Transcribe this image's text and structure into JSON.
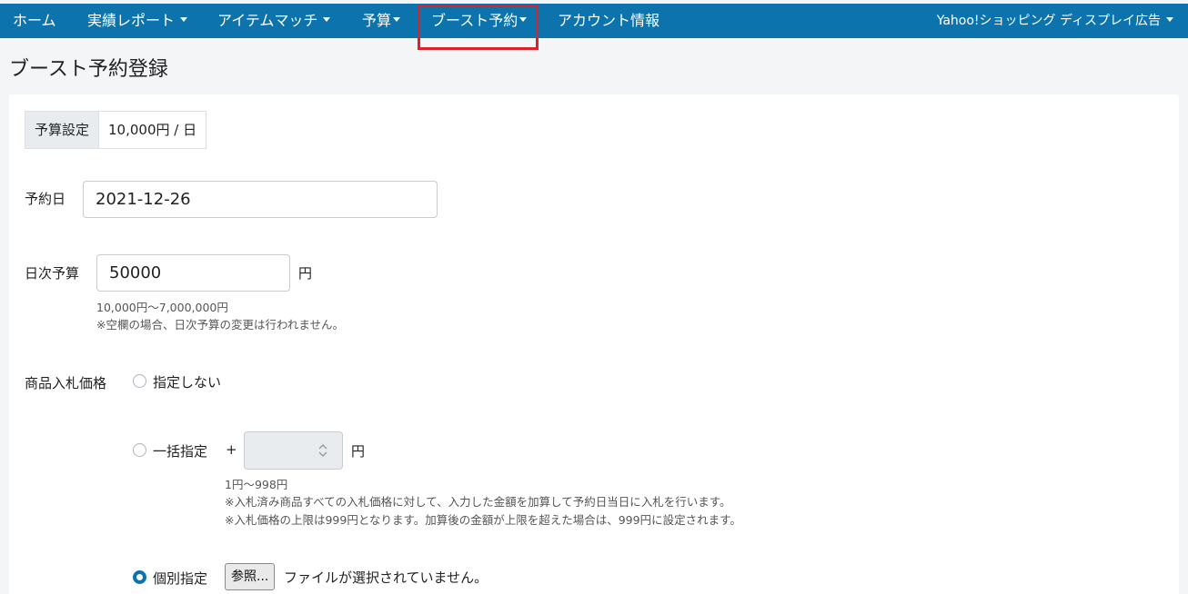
{
  "navbar": {
    "items": [
      {
        "label": "ホーム",
        "dropdown": false
      },
      {
        "label": "実績レポート",
        "dropdown": true
      },
      {
        "label": "アイテムマッチ",
        "dropdown": true
      },
      {
        "label": "予算",
        "dropdown": true
      },
      {
        "label": "ブースト予約",
        "dropdown": true,
        "active": true
      },
      {
        "label": "アカウント情報",
        "dropdown": false
      }
    ],
    "account": "Yahoo!ショッピング ディスプレイ広告",
    "bg_color": "#0c73ad",
    "highlight_color": "#d9222a"
  },
  "page": {
    "title": "ブースト予約登録"
  },
  "budget": {
    "label": "予算設定",
    "value": "10,000円 / 日"
  },
  "reservation_date": {
    "label": "予約日",
    "value": "2021-12-26"
  },
  "daily_budget": {
    "label": "日次予算",
    "value": "50000",
    "unit": "円",
    "range": "10,000円～7,000,000円",
    "note": "※空欄の場合、日次予算の変更は行われません。"
  },
  "bid_price": {
    "label": "商品入札価格",
    "options": {
      "none": "指定しない",
      "bulk": "一括指定",
      "individual": "個別指定"
    },
    "selected": "individual",
    "bulk_prefix": "+",
    "bulk_unit": "円",
    "bulk_range": "1円～998円",
    "bulk_note1": "※入札済み商品すべての入札価格に対して、入力した金額を加算して予約日当日に入札を行います。",
    "bulk_note2": "※入札価格の上限は999円となります。加算後の金額が上限を超えた場合は、999円に設定されます。",
    "file_button": "参照...",
    "file_status": "ファイルが選択されていません。"
  }
}
